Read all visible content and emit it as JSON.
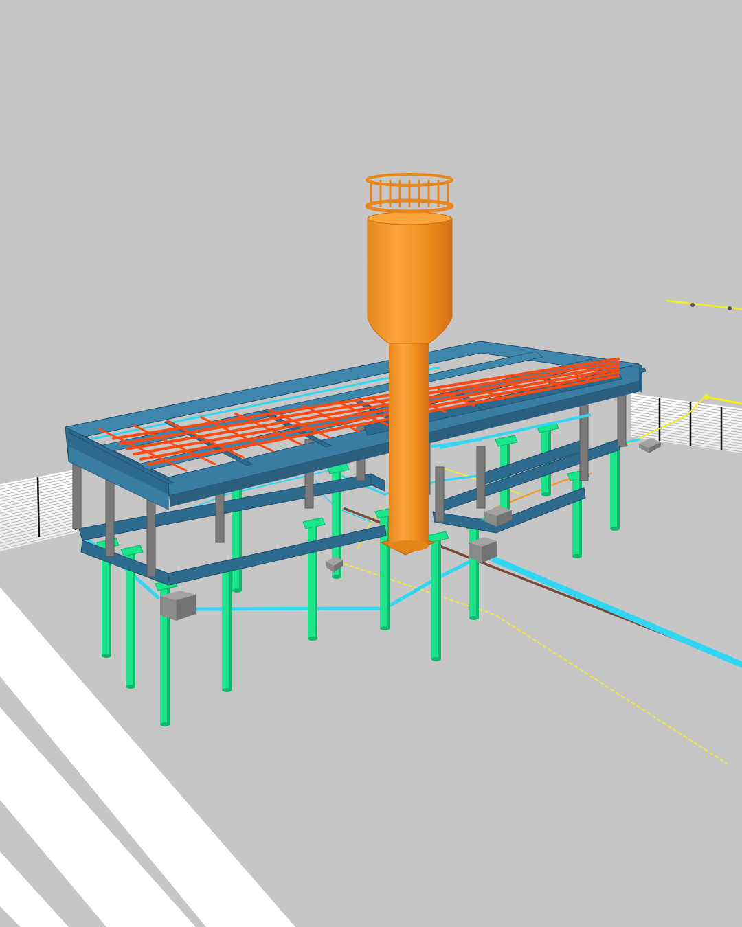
{
  "scene": {
    "kind": "bim-3d-model-view",
    "labels": [],
    "colors": {
      "background": "#c6c6c6",
      "ground": "#c9c9c9",
      "road_marking": "#ffffff",
      "fence": "#f4f4f4",
      "fence_post": "#111111",
      "steel_frame": "#2e6b8e",
      "steel_frame_light": "#3f86ad",
      "roof_joists": "#ff4a12",
      "columns": "#7a7a7a",
      "piles": "#19e58a",
      "pile_dark": "#0fb86a",
      "water_tank": "#f4921e",
      "water_tank_dark": "#d9741a",
      "water_pipe": "#30d6f2",
      "electrical_line": "#f1ee1c",
      "drain_pipe": "#7a4a3a",
      "equipment_box": "#8a8a8a"
    },
    "elements": [
      "road-markings",
      "perimeter-fence-left",
      "perimeter-fence-right",
      "electrical-lines",
      "water-pipe-network",
      "drain-pipe",
      "pile-foundations",
      "steel-columns",
      "lower-floor-frame",
      "roof-frame",
      "roof-joists",
      "equipment-boxes",
      "water-tower"
    ]
  }
}
